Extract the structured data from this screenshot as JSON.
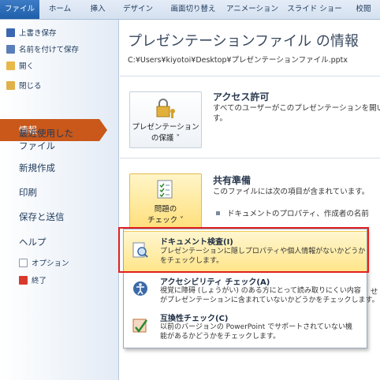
{
  "ribbon": {
    "tabs": [
      "ファイル",
      "ホーム",
      "挿入",
      "デザイン",
      "画面切り替え",
      "アニメーション",
      "スライド ショー",
      "校閲"
    ]
  },
  "sidebar": {
    "save": "上書き保存",
    "save_as": "名前を付けて保存",
    "open": "開く",
    "close": "閉じる",
    "info": "情報",
    "recent_line1": "最近使用した",
    "recent_line2": "ファイル",
    "new": "新規作成",
    "print": "印刷",
    "save_send": "保存と送信",
    "help": "ヘルプ",
    "options": "オプション",
    "exit": "終了"
  },
  "main": {
    "title": "プレゼンテーションファイル の情報",
    "path": "C:¥Users¥kiyotoi¥Desktop¥プレゼンテーションファイル.pptx",
    "protect_button_line1": "プレゼンテーション",
    "protect_button_line2": "の保護 ˅",
    "permissions_title": "アクセス許可",
    "permissions_line1": "すべてのユーザーがこのプレゼンテーションを開いて",
    "permissions_line2": "す。",
    "check_button_line1": "問題の",
    "check_button_line2": "チェック ˅",
    "share_title": "共有準備",
    "share_line1": "このファイルには次の項目が含まれています。",
    "share_bullet1": "ドキュメントのプロパティ、作成者の名前",
    "share_partial": "せ"
  },
  "menu": {
    "inspect_title": "ドキュメント検査(I)",
    "inspect_desc": "プレゼンテーションに隠しプロパティや個人情報がないかどうか\nをチェックします。",
    "access_title": "アクセシビリティ チェック(A)",
    "access_desc": "視覚に障碍 (しょうがい) のある方にとって読み取りにくい内容\nがプレゼンテーションに含まれていないかどうかをチェックします。",
    "compat_title": "互換性チェック(C)",
    "compat_desc": "以前のバージョンの PowerPoint でサポートされていない機\n能があるかどうかをチェックします。"
  },
  "colors": {
    "file_tab": "#1f5ea9",
    "info_selected": "#c9581a",
    "highlight": "#ffe58a",
    "callout": "#e02020"
  }
}
